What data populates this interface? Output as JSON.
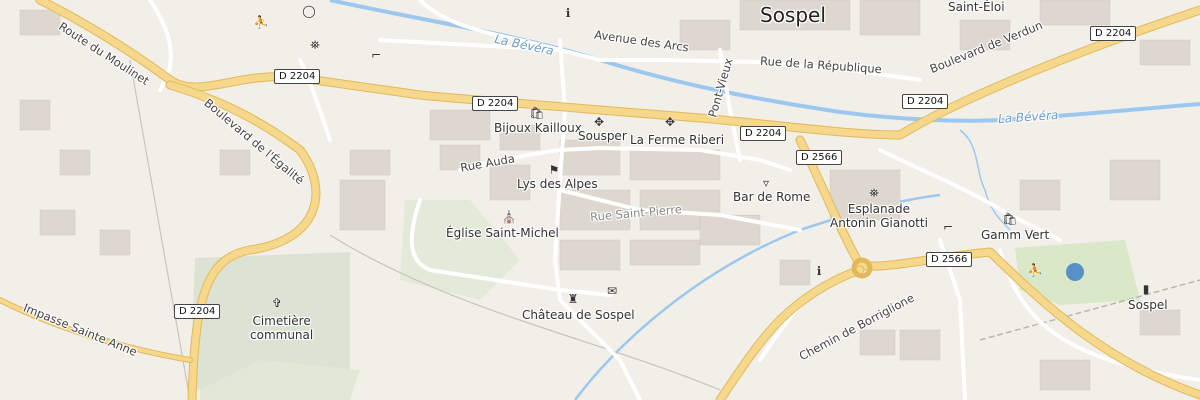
{
  "colors": {
    "land": "#f2efe9",
    "building": "#ddd7cf",
    "major_road": "#f6d88c",
    "major_road_casing": "#e2b85a",
    "minor_road": "#ffffff",
    "river": "#9cc8f0",
    "park": "#d9e8c8",
    "cemetery": "#dce3d4",
    "pond": "#5a90c8"
  },
  "places": {
    "town": "Sospel",
    "district": "Saint-Éloi"
  },
  "rivers": {
    "north": "La Bévéra",
    "east": "La Bévéra"
  },
  "streets": {
    "route_du_moulinet": "Route du Moulinet",
    "avenue_des_arcs": "Avenue des Arcs",
    "rue_republique": "Rue de la République",
    "bd_verdun": "Boulevard de Verdun",
    "bd_egalite": "Boulevard de l'Égalité",
    "rue_auda": "Rue Auda",
    "pont_vieux": "Pont-Vieux",
    "rue_saint_pierre": "Rue Saint-Pierre",
    "chemin_borriglione": "Chemin de Borriglione",
    "impasse_sainte_anne": "Impasse Sainte Anne"
  },
  "road_shields": {
    "d2204_a": "D 2204",
    "d2204_b": "D 2204",
    "d2204_c": "D 2204",
    "d2204_d": "D 2204",
    "d2204_e": "D 2204",
    "d2204_f": "D 2204",
    "d2566_a": "D 2566",
    "d2566_b": "D 2566"
  },
  "pois": {
    "bijoux": {
      "label": "Bijoux Kailloux",
      "icon": "shop-bag-icon"
    },
    "sousper": {
      "label": "Sousper",
      "icon": "restaurant-icon"
    },
    "ferme": {
      "label": "La Ferme Riberi",
      "icon": "restaurant-icon"
    },
    "lys": {
      "label": "Lys des Alpes",
      "icon": "clothes-icon"
    },
    "bar_rome": {
      "label": "Bar de Rome",
      "icon": "bar-icon"
    },
    "esplanade": {
      "label": "Esplanade\nAntonin Gianotti",
      "icon": "monument-icon"
    },
    "gamm_vert": {
      "label": "Gamm Vert",
      "icon": "shop-bag-icon"
    },
    "eglise": {
      "label": "Église Saint-Michel",
      "icon": "church-icon"
    },
    "chateau": {
      "label": "Château de Sospel",
      "icon": "castle-icon"
    },
    "cimetiere": {
      "label": "Cimetière\ncommunal",
      "icon": "cemetery-icon"
    },
    "station": {
      "label": "Sospel",
      "icon": "train-icon"
    }
  }
}
